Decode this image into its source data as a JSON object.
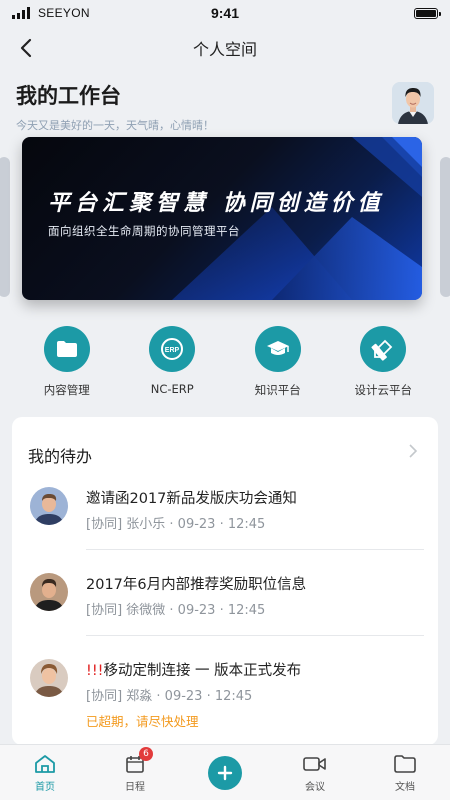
{
  "status_bar": {
    "carrier": "SEEYON",
    "time": "9:41"
  },
  "nav": {
    "title": "个人空间"
  },
  "workspace": {
    "title": "我的工作台",
    "greeting": "今天又是美好的一天，天气晴，心情晴！"
  },
  "banner": {
    "slogan": "平台汇聚智慧 协同创造价值",
    "subtitle": "面向组织全生命周期的协同管理平台"
  },
  "quick_apps": [
    {
      "label": "内容管理",
      "icon": "folder-icon"
    },
    {
      "label": "NC-ERP",
      "icon": "erp-icon"
    },
    {
      "label": "知识平台",
      "icon": "graduation-cap-icon"
    },
    {
      "label": "设计云平台",
      "icon": "design-tools-icon"
    }
  ],
  "todo": {
    "title": "我的待办",
    "items": [
      {
        "urgent_prefix": "",
        "title": "邀请函2017新品发版庆功会通知",
        "meta": "[协同] 张小乐 · 09-23 · 12:45",
        "warning": ""
      },
      {
        "urgent_prefix": "",
        "title": "2017年6月内部推荐奖励职位信息",
        "meta": "[协同] 徐微微 · 09-23 · 12:45",
        "warning": ""
      },
      {
        "urgent_prefix": "!!!",
        "title": "移动定制连接 一 版本正式发布",
        "meta": "[协同] 郑淼 · 09-23 · 12:45",
        "warning": "已超期，请尽快处理"
      }
    ]
  },
  "tab_bar": {
    "items": [
      {
        "label": "首页",
        "icon": "home-icon",
        "active": true
      },
      {
        "label": "日程",
        "icon": "calendar-icon",
        "badge": "6"
      },
      {
        "label": "",
        "icon": "plus-icon"
      },
      {
        "label": "会议",
        "icon": "video-icon"
      },
      {
        "label": "文档",
        "icon": "folder-icon"
      }
    ]
  },
  "colors": {
    "accent": "#1c9aa6",
    "badge": "#e23b3b",
    "warning": "#f39a1f",
    "urgent": "#e02020"
  }
}
